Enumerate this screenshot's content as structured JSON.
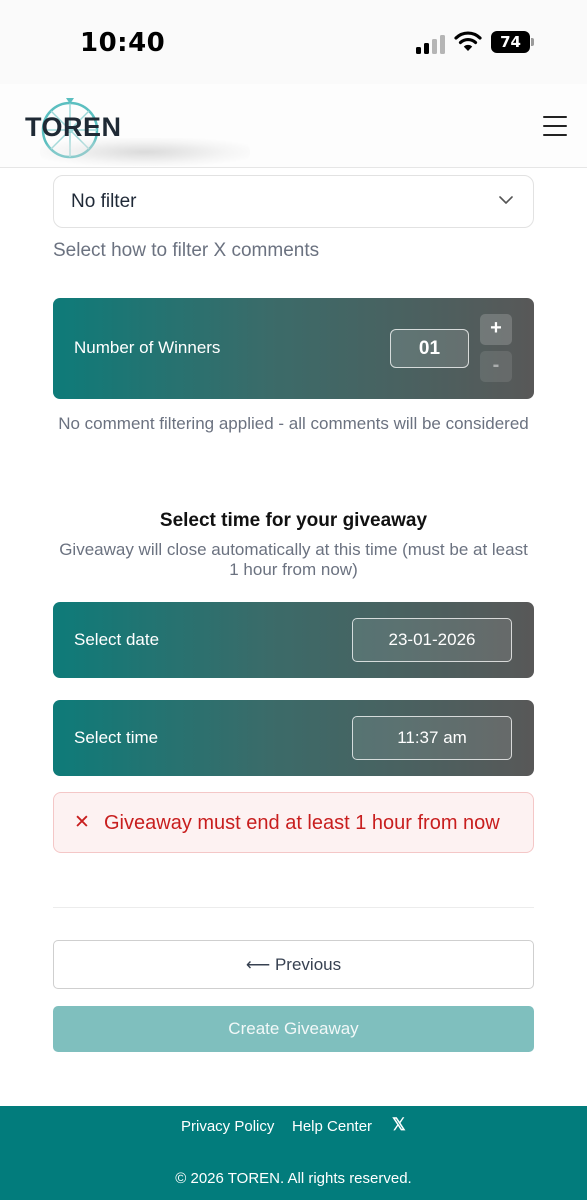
{
  "status_bar": {
    "time": "10:40",
    "battery_level": "74"
  },
  "header": {
    "logo_text": "TOREN"
  },
  "filter": {
    "selected": "No filter",
    "helper": "Select how to filter X comments"
  },
  "winners": {
    "label": "Number of Winners",
    "value": "01",
    "plus_label": "+",
    "minus_label": "-"
  },
  "filter_note": "No comment filtering applied - all comments will be considered",
  "schedule": {
    "title": "Select time for your giveaway",
    "subtitle": "Giveaway will close automatically at this time (must be at least 1 hour from now)",
    "date_label": "Select date",
    "date_value": "23-01-2026",
    "time_label": "Select time",
    "time_value": "11:37 am"
  },
  "error": {
    "icon": "✕",
    "message": "Giveaway must end at least 1 hour from now"
  },
  "actions": {
    "previous_label": "⟵ Previous",
    "create_label": "Create Giveaway"
  },
  "footer": {
    "privacy": "Privacy Policy",
    "help": "Help Center",
    "x_label": "𝕏",
    "copyright": "© 2026 TOREN. All rights reserved."
  },
  "colors": {
    "brand_teal": "#027c7c",
    "error_red": "#c81e1e",
    "disabled_button": "#7fbfbe"
  }
}
